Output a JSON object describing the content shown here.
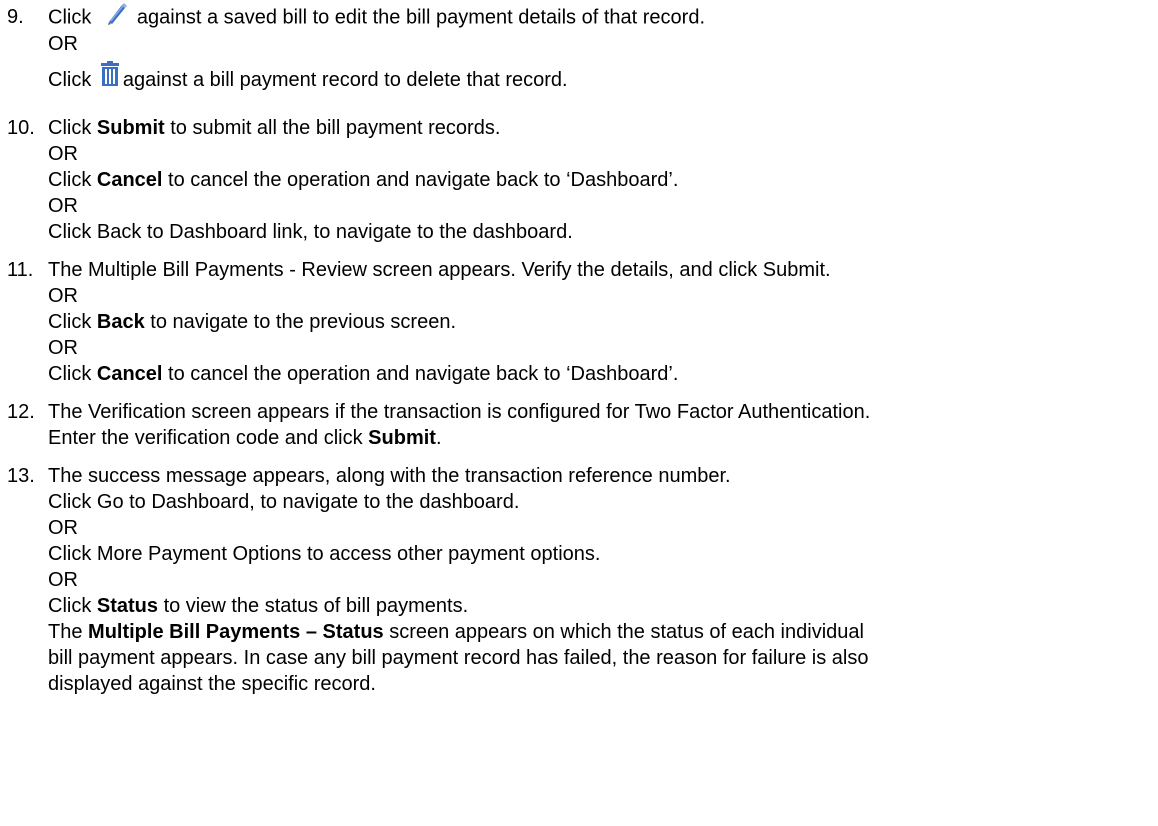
{
  "step9": {
    "number": "9.",
    "click_word": "Click",
    "edit_text": "against a saved bill to edit the bill payment details of that record.",
    "or1": "OR",
    "delete_text": "against a bill payment record to delete that record.",
    "edit_icon": "pencil-icon",
    "delete_icon": "trash-icon"
  },
  "step10": {
    "number": "10.",
    "line1_pre": "Click ",
    "line1_bold": "Submit",
    "line1_post": " to submit all the bill payment records.",
    "or1": "OR",
    "line2_pre": "Click ",
    "line2_bold": "Cancel",
    "line2_post": " to cancel the operation and navigate back to ‘Dashboard’.",
    "or2": "OR",
    "line3": "Click Back to Dashboard link, to navigate to the dashboard."
  },
  "step11": {
    "number": "11.",
    "line1": "The Multiple Bill Payments - Review screen appears. Verify the details, and click Submit.",
    "or1": "OR",
    "line2_pre": "Click ",
    "line2_bold": "Back",
    "line2_post": " to navigate to the previous screen.",
    "or2": "OR",
    "line3_pre": "Click ",
    "line3_bold": "Cancel",
    "line3_post": " to cancel the operation and navigate back to ‘Dashboard’."
  },
  "step12": {
    "number": "12.",
    "line1": "The Verification screen appears if the transaction is configured for Two Factor Authentication.",
    "line2_pre": "Enter the verification code and click ",
    "line2_bold": "Submit",
    "line2_post": "."
  },
  "step13": {
    "number": "13.",
    "line1": "The success message appears, along with the transaction reference number.",
    "line2": "Click Go to Dashboard, to navigate to the dashboard.",
    "or1": "OR",
    "line3": "Click More Payment Options to access other payment options.",
    "or2": "OR",
    "line4_pre": "Click ",
    "line4_bold": "Status",
    "line4_post": " to view the status of bill payments.",
    "line5_pre": "The ",
    "line5_bold": "Multiple Bill Payments – Status",
    "line5_post": " screen appears on which the status of each individual",
    "line6": "bill payment appears. In case any bill payment record has failed, the reason for failure is also",
    "line7": "displayed against the specific record."
  },
  "colors": {
    "text": "#000000",
    "icon_blue": "#3b6fc4",
    "icon_light_blue": "#8fb3e8"
  }
}
